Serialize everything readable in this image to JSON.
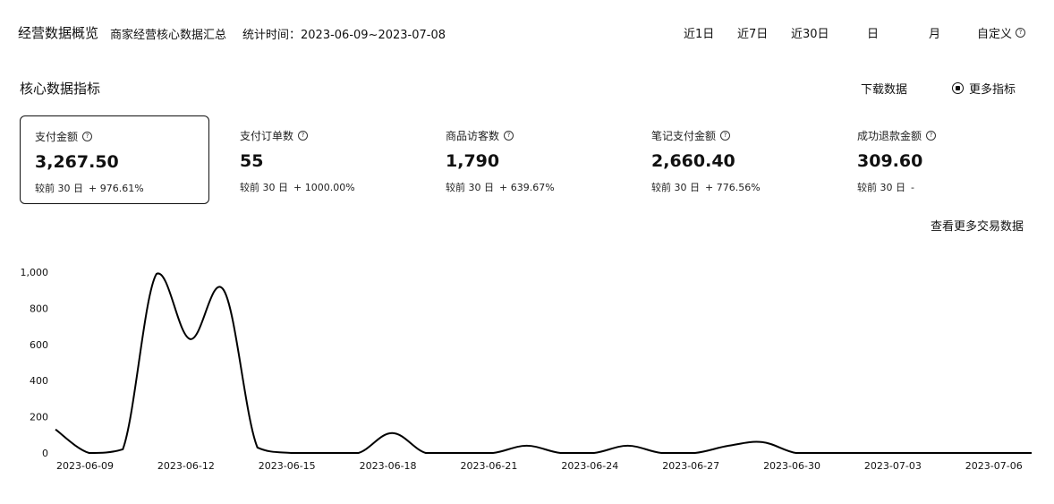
{
  "header": {
    "title": "经营数据概览",
    "subtitle": "商家经营核心数据汇总",
    "time_label": "统计时间：2023-06-09~2023-07-08",
    "ranges": [
      "近1日",
      "近7日",
      "近30日",
      "日",
      "月"
    ],
    "custom_label": "自定义"
  },
  "section": {
    "title": "核心数据指标",
    "download": "下载数据",
    "more_metrics": "更多指标",
    "more_trade": "查看更多交易数据"
  },
  "metrics": [
    {
      "label": "支付金额",
      "value": "3,267.50",
      "compare_label": "较前 30 日",
      "compare_value": "+ 976.61%",
      "selected": true
    },
    {
      "label": "支付订单数",
      "value": "55",
      "compare_label": "较前 30 日",
      "compare_value": "+ 1000.00%",
      "selected": false
    },
    {
      "label": "商品访客数",
      "value": "1,790",
      "compare_label": "较前 30 日",
      "compare_value": "+ 639.67%",
      "selected": false
    },
    {
      "label": "笔记支付金额",
      "value": "2,660.40",
      "compare_label": "较前 30 日",
      "compare_value": "+ 776.56%",
      "selected": false
    },
    {
      "label": "成功退款金额",
      "value": "309.60",
      "compare_label": "较前 30 日",
      "compare_value": "-",
      "selected": false
    }
  ],
  "chart_data": {
    "type": "line",
    "x": [
      "2023-06-09",
      "2023-06-10",
      "2023-06-11",
      "2023-06-12",
      "2023-06-13",
      "2023-06-14",
      "2023-06-15",
      "2023-06-16",
      "2023-06-17",
      "2023-06-18",
      "2023-06-19",
      "2023-06-20",
      "2023-06-21",
      "2023-06-22",
      "2023-06-23",
      "2023-06-24",
      "2023-06-25",
      "2023-06-26",
      "2023-06-27",
      "2023-06-28",
      "2023-06-29",
      "2023-06-30",
      "2023-07-01",
      "2023-07-02",
      "2023-07-03",
      "2023-07-04",
      "2023-07-05",
      "2023-07-06",
      "2023-07-07",
      "2023-07-08"
    ],
    "x_ticks": [
      "2023-06-09",
      "2023-06-12",
      "2023-06-15",
      "2023-06-18",
      "2023-06-21",
      "2023-06-24",
      "2023-06-27",
      "2023-06-30",
      "2023-07-03",
      "2023-07-06"
    ],
    "series": [
      {
        "values": [
          130,
          0,
          20,
          990,
          630,
          900,
          30,
          0,
          0,
          0,
          110,
          0,
          0,
          0,
          40,
          0,
          0,
          40,
          0,
          0,
          40,
          60,
          0,
          0,
          0,
          0,
          0,
          0,
          0,
          0
        ]
      }
    ],
    "y_ticks": [
      0,
      200,
      400,
      600,
      800,
      1000
    ],
    "y_tick_labels": [
      "0",
      "200",
      "400",
      "600",
      "800",
      "1,000"
    ],
    "ylim": [
      0,
      1000
    ],
    "grid": false,
    "color": "#000000"
  }
}
